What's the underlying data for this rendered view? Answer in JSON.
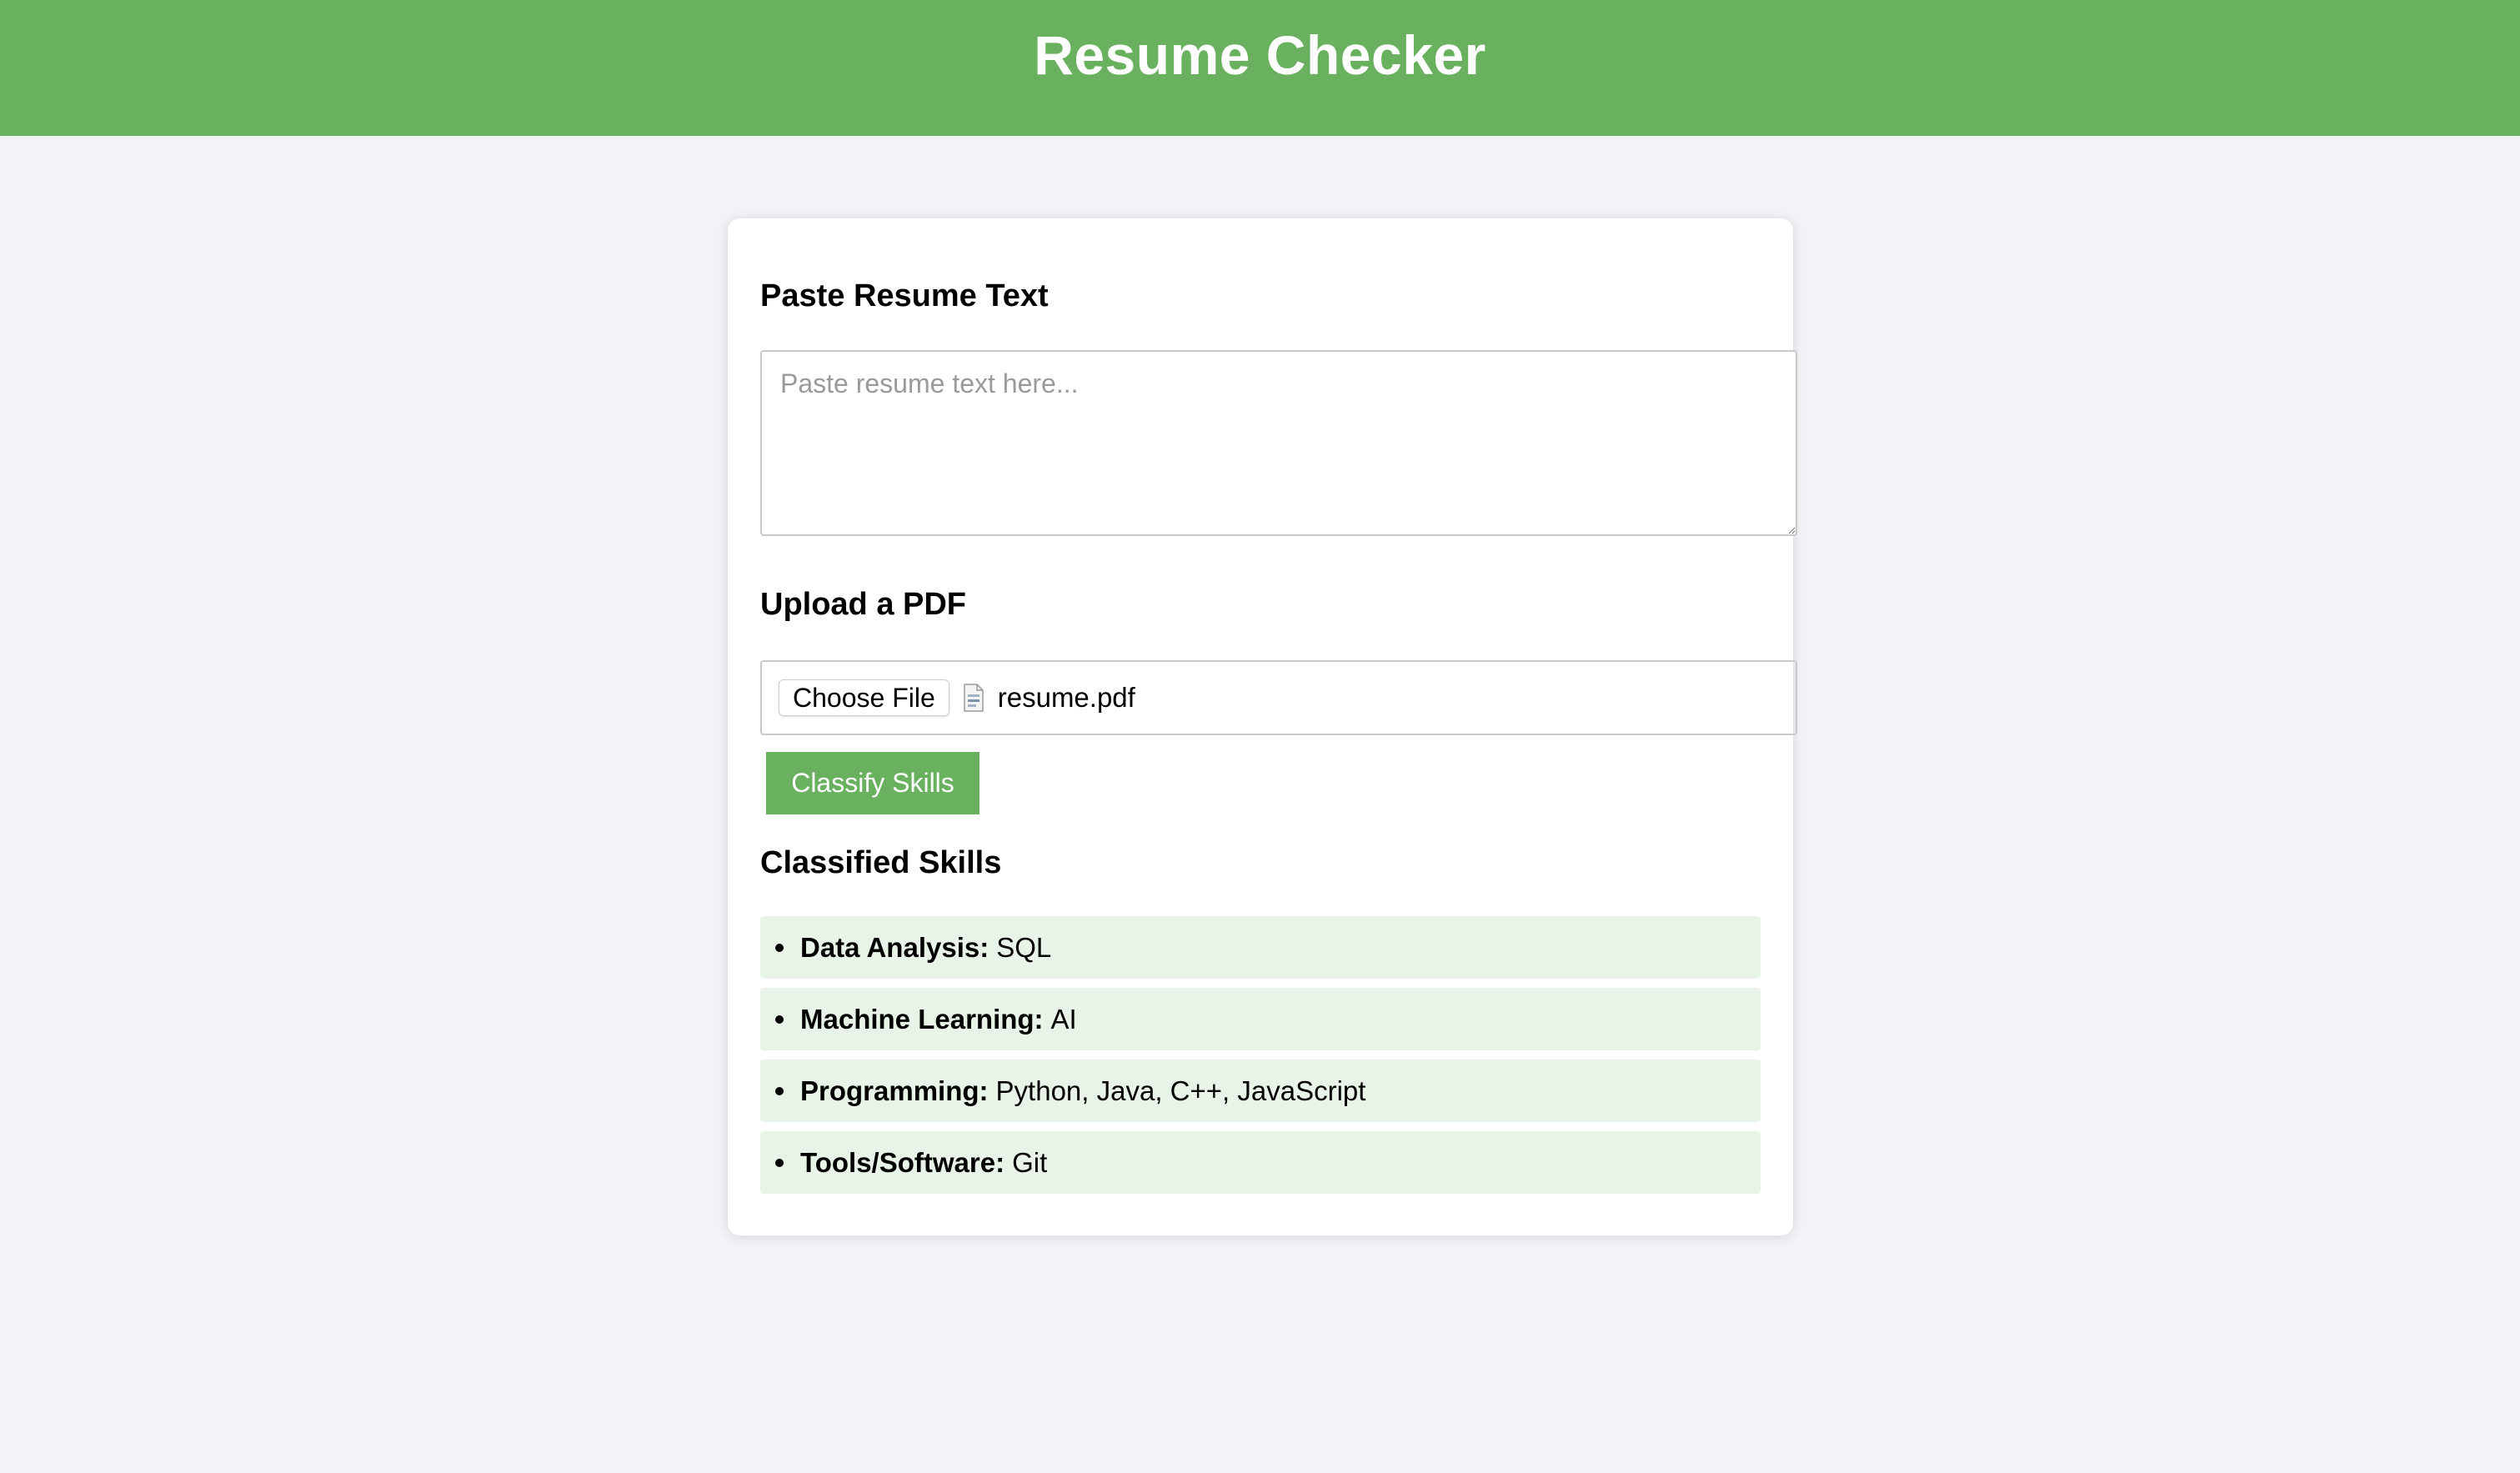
{
  "header": {
    "title": "Resume Checker",
    "color": "#69b05f"
  },
  "paste": {
    "heading": "Paste Resume Text",
    "placeholder": "Paste resume text here...",
    "value": ""
  },
  "upload": {
    "heading": "Upload a PDF",
    "choose_label": "Choose File",
    "file_icon": "pdf-file-icon",
    "file_name": "resume.pdf"
  },
  "classify_button": {
    "label": "Classify Skills"
  },
  "results": {
    "heading": "Classified Skills",
    "items": [
      {
        "category": "Data Analysis:",
        "skills": "SQL"
      },
      {
        "category": "Machine Learning:",
        "skills": "AI"
      },
      {
        "category": "Programming:",
        "skills": "Python, Java, C++, JavaScript"
      },
      {
        "category": "Tools/Software:",
        "skills": "Git"
      }
    ]
  }
}
